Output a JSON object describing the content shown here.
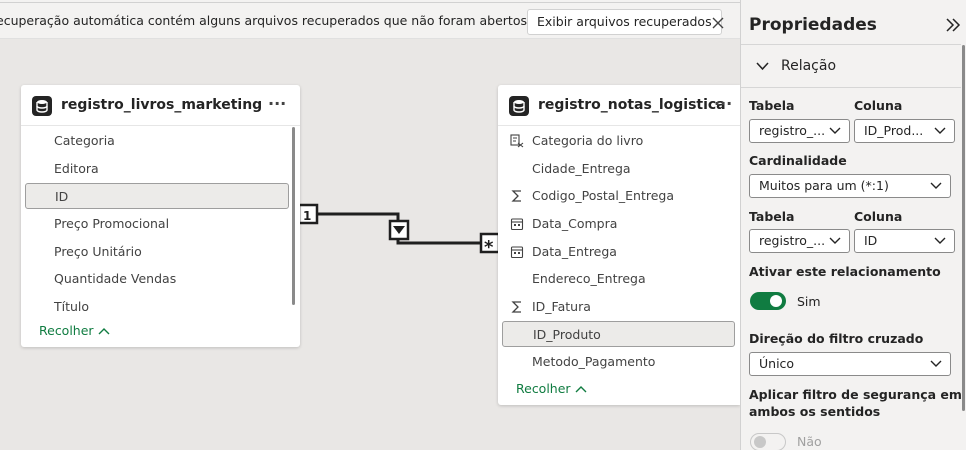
{
  "banner": {
    "message": "ecuperação automática contém alguns arquivos recuperados que não foram abertos.",
    "button_label": "Exibir arquivos recuperados",
    "close_icon": "close-icon"
  },
  "tables": [
    {
      "title": "registro_livros_marketing",
      "more": "···",
      "fields": [
        "Categoria",
        "Editora",
        "ID",
        "Preço Promocional",
        "Preço Unitário",
        "Quantidade Vendas",
        "Título"
      ],
      "selected_field": "ID",
      "collapse_label": "Recolher"
    },
    {
      "title": "registro_notas_logistica",
      "more": "···",
      "fields": [
        {
          "label": "Categoria do livro",
          "icon": "hierarchy-icon"
        },
        {
          "label": "Cidade_Entrega",
          "icon": ""
        },
        {
          "label": "Codigo_Postal_Entrega",
          "icon": "sigma-icon"
        },
        {
          "label": "Data_Compra",
          "icon": "calendar-icon"
        },
        {
          "label": "Data_Entrega",
          "icon": "calendar-icon"
        },
        {
          "label": "Endereco_Entrega",
          "icon": ""
        },
        {
          "label": "ID_Fatura",
          "icon": "sigma-icon"
        },
        {
          "label": "ID_Produto",
          "icon": ""
        },
        {
          "label": "Metodo_Pagamento",
          "icon": ""
        }
      ],
      "selected_field": "ID_Produto",
      "collapse_label": "Recolher"
    }
  ],
  "relationship": {
    "from_cardinality": "1",
    "to_cardinality": "*",
    "filter_direction_icon": "filter-direction-icon"
  },
  "properties": {
    "title": "Propriedades",
    "section": "Relação",
    "table_label": "Tabela",
    "column_label": "Coluna",
    "table1_value": "registro_...",
    "column1_value": "ID_Prod...",
    "cardinality_label": "Cardinalidade",
    "cardinality_value": "Muitos para um (*:1)",
    "table2_value": "registro_...",
    "column2_value": "ID",
    "active_label": "Ativar este relacionamento",
    "active_value": "Sim",
    "crossfilter_label": "Direção do filtro cruzado",
    "crossfilter_value": "Único",
    "security_label_1": "Aplicar filtro de segurança em",
    "security_label_2": "ambos os sentidos",
    "security_value": "Não"
  }
}
